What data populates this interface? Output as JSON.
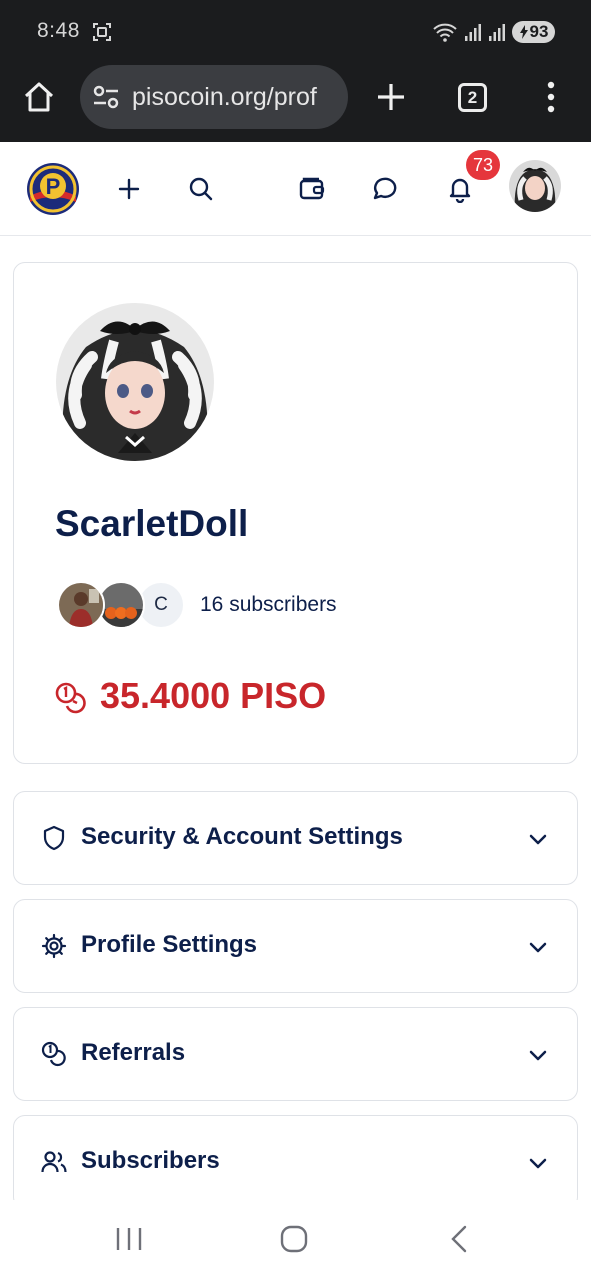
{
  "status_bar": {
    "time": "8:48",
    "battery": "93"
  },
  "browser": {
    "url": "pisocoin.org/prof",
    "tab_count": "2"
  },
  "header": {
    "notification_count": "73"
  },
  "profile": {
    "username": "ScarletDoll",
    "subscriber_avatar_initial": "C",
    "subscribers_label": "16 subscribers",
    "balance": "35.4000 PISO"
  },
  "panels": [
    {
      "label": "Security & Account Settings",
      "icon": "shield-icon"
    },
    {
      "label": "Profile Settings",
      "icon": "gear-icon"
    },
    {
      "label": "Referrals",
      "icon": "coins-icon"
    },
    {
      "label": "Subscribers",
      "icon": "users-icon"
    }
  ],
  "colors": {
    "navy_text": "#0d1f4a",
    "balance_red": "#c8262b",
    "badge_red": "#e5363c",
    "browser_dark": "#1b1c1e"
  }
}
